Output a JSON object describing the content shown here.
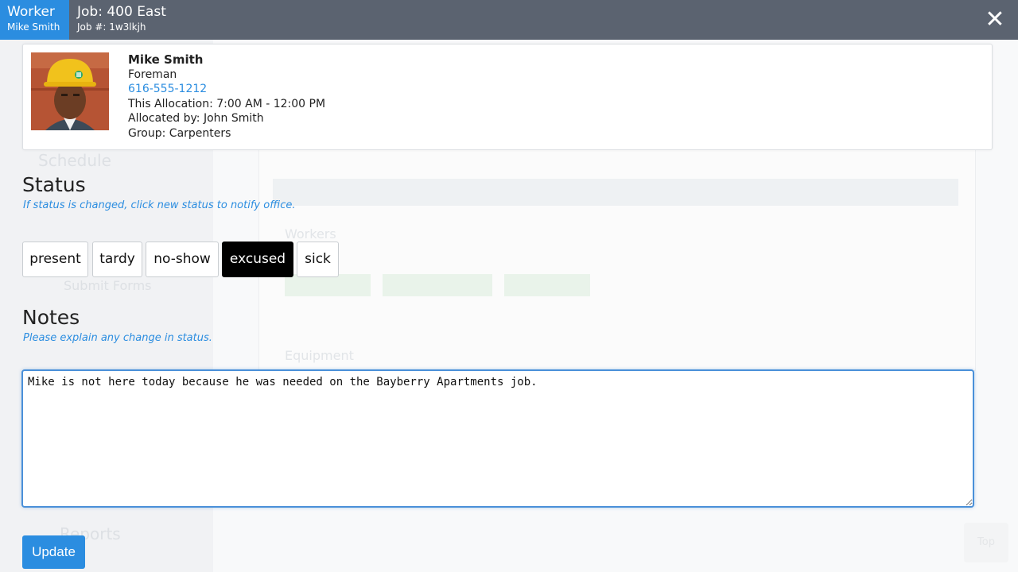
{
  "header": {
    "worker_label": "Worker",
    "worker_name": "Mike Smith",
    "job_title": "Job: 400 East",
    "job_number": "Job #: 1w3lkjh",
    "close_icon": "close-icon"
  },
  "worker": {
    "name": "Mike Smith",
    "role": "Foreman",
    "phone": "616-555-1212",
    "allocation": "This Allocation: 7:00 AM - 12:00 PM",
    "allocated_by": "Allocated by: John Smith",
    "group": "Group: Carpenters"
  },
  "status": {
    "title": "Status",
    "hint": "If status is changed, click new status to notify office.",
    "options": [
      "present",
      "tardy",
      "no-show",
      "excused",
      "sick"
    ],
    "selected": "excused"
  },
  "notes": {
    "title": "Notes",
    "hint": "Please explain any change in status.",
    "value": "Mike is not here today because he was needed on the Bayberry Apartments job."
  },
  "actions": {
    "update_label": "Update"
  },
  "colors": {
    "accent": "#2b8de0",
    "header": "#5b6370",
    "selected_status": "#000000"
  }
}
